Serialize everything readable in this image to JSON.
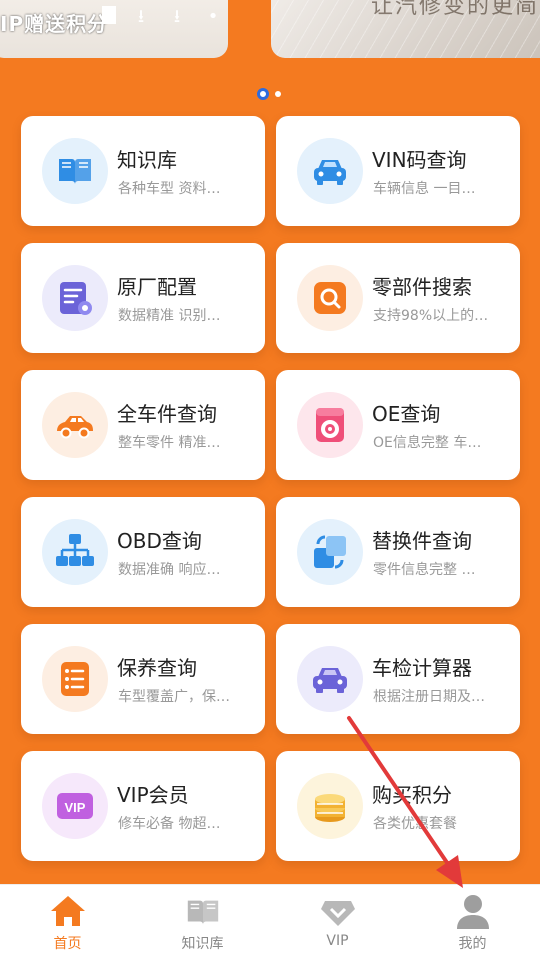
{
  "banner": {
    "left_text": "IP赠送积分",
    "right_text": "让汽修变的更简",
    "pagination": {
      "count": 2,
      "active_index": 0
    }
  },
  "features": [
    {
      "title": "知识库",
      "subtitle": "各种车型 资料…",
      "icon": "book-icon",
      "circle": "#e4f1fc",
      "color": "#2f8de4"
    },
    {
      "title": "VIN码查询",
      "subtitle": "车辆信息 一目…",
      "icon": "car-icon",
      "circle": "#e4f1fc",
      "color": "#2f8de4"
    },
    {
      "title": "原厂配置",
      "subtitle": "数据精准 识别…",
      "icon": "config-doc-icon",
      "circle": "#ecebfb",
      "color": "#6b63d8"
    },
    {
      "title": "零部件搜索",
      "subtitle": "支持98%以上的…",
      "icon": "search-box-icon",
      "circle": "#fdeee2",
      "color": "#f47a20"
    },
    {
      "title": "全车件查询",
      "subtitle": "整车零件 精准…",
      "icon": "car-orange-icon",
      "circle": "#fdeee2",
      "color": "#f47a20"
    },
    {
      "title": "OE查询",
      "subtitle": "OE信息完整 车…",
      "icon": "washer-icon",
      "circle": "#fde6ec",
      "color": "#ef4f79"
    },
    {
      "title": "OBD查询",
      "subtitle": "数据准确 响应…",
      "icon": "network-icon",
      "circle": "#e4f1fc",
      "color": "#2f8de4"
    },
    {
      "title": "替换件查询",
      "subtitle": "零件信息完整 …",
      "icon": "swap-icon",
      "circle": "#e4f1fc",
      "color": "#2f8de4"
    },
    {
      "title": "保养查询",
      "subtitle": "车型覆盖广，保…",
      "icon": "list-icon",
      "circle": "#fdeee2",
      "color": "#f47a20"
    },
    {
      "title": "车检计算器",
      "subtitle": "根据注册日期及…",
      "icon": "car-purple-icon",
      "circle": "#ecebfb",
      "color": "#6b63d8"
    },
    {
      "title": "VIP会员",
      "subtitle": "修车必备 物超…",
      "icon": "vip-icon",
      "circle": "#f6e8fb",
      "color": "#c060e0"
    },
    {
      "title": "购买积分",
      "subtitle": "各类优惠套餐",
      "icon": "coins-icon",
      "circle": "#fdf4dc",
      "color": "#f2b233"
    }
  ],
  "nav": {
    "items": [
      {
        "label": "首页",
        "icon": "home-icon",
        "active": true
      },
      {
        "label": "知识库",
        "icon": "book-icon",
        "active": false
      },
      {
        "label": "VIP",
        "icon": "vip-diamond-icon",
        "active": false
      },
      {
        "label": "我的",
        "icon": "user-icon",
        "active": false
      }
    ],
    "active_color": "#f47a20",
    "inactive_color": "#888888"
  },
  "colors": {
    "background": "#f47a20",
    "annotation": "#e23a3a"
  }
}
